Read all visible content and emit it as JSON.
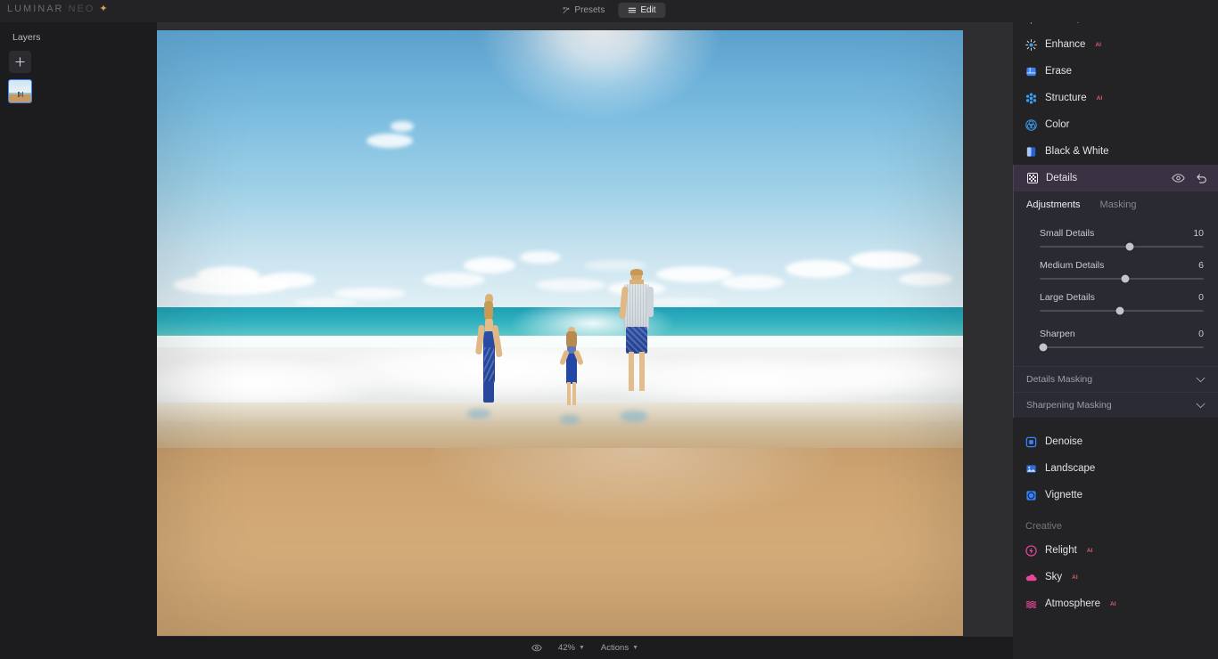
{
  "app": {
    "name": "LUMINAR",
    "name_suffix": "NEO",
    "logo_mark": "sparkle-icon"
  },
  "topbar": {
    "tabs": [
      {
        "label": "Presets",
        "icon": "presets-icon",
        "active": false
      },
      {
        "label": "Edit",
        "icon": "edit-sliders-icon",
        "active": true
      }
    ]
  },
  "left_panel": {
    "title": "Layers",
    "add_button": "add-layer-icon",
    "layers": [
      {
        "name": "beach-photo-layer",
        "selected": true
      }
    ]
  },
  "canvas": {
    "image_alt": "Family of three holding hands on a sunny beach with breaking waves"
  },
  "bottombar": {
    "preview_toggle": "eye-icon",
    "zoom_level": "42%",
    "actions_label": "Actions"
  },
  "right_panel": {
    "tools": [
      {
        "label": "Develop",
        "icon": "sun-icon",
        "ai": false
      },
      {
        "label": "Enhance",
        "icon": "sparkle-icon",
        "ai": true
      },
      {
        "label": "Erase",
        "icon": "eraser-icon",
        "ai": false
      },
      {
        "label": "Structure",
        "icon": "structure-dots-icon",
        "ai": true
      },
      {
        "label": "Color",
        "icon": "color-circles-icon",
        "ai": false
      },
      {
        "label": "Black & White",
        "icon": "bw-split-icon",
        "ai": false
      }
    ],
    "details": {
      "title": "Details",
      "icon": "details-grid-icon",
      "visibility_icon": "eye-icon",
      "reset_icon": "undo-icon",
      "tabs": [
        {
          "label": "Adjustments",
          "active": true
        },
        {
          "label": "Masking",
          "active": false
        }
      ],
      "sliders": [
        {
          "label": "Small Details",
          "value": "10",
          "pos": 55
        },
        {
          "label": "Medium Details",
          "value": "6",
          "pos": 52
        },
        {
          "label": "Large Details",
          "value": "0",
          "pos": 49
        },
        {
          "label": "Sharpen",
          "value": "0",
          "pos": 2
        }
      ],
      "collapsibles": [
        {
          "label": "Details Masking",
          "icon": "chevron-down-icon"
        },
        {
          "label": "Sharpening Masking",
          "icon": "chevron-down-icon"
        }
      ]
    },
    "tools_after": [
      {
        "label": "Denoise",
        "icon": "denoise-icon",
        "ai": false
      },
      {
        "label": "Landscape",
        "icon": "landscape-icon",
        "ai": false
      },
      {
        "label": "Vignette",
        "icon": "vignette-icon",
        "ai": false
      }
    ],
    "creative": {
      "title": "Creative",
      "tools": [
        {
          "label": "Relight",
          "icon": "relight-icon",
          "ai": true
        },
        {
          "label": "Sky",
          "icon": "sky-cloud-icon",
          "ai": true
        },
        {
          "label": "Atmosphere",
          "icon": "atmosphere-waves-icon",
          "ai": true
        }
      ]
    }
  },
  "colors": {
    "accent_blue": "#3b82f6",
    "accent_pink": "#e8469a",
    "ai_badge": "#d45f6a",
    "panel_bg": "#232325",
    "details_header": "#3a3142"
  }
}
